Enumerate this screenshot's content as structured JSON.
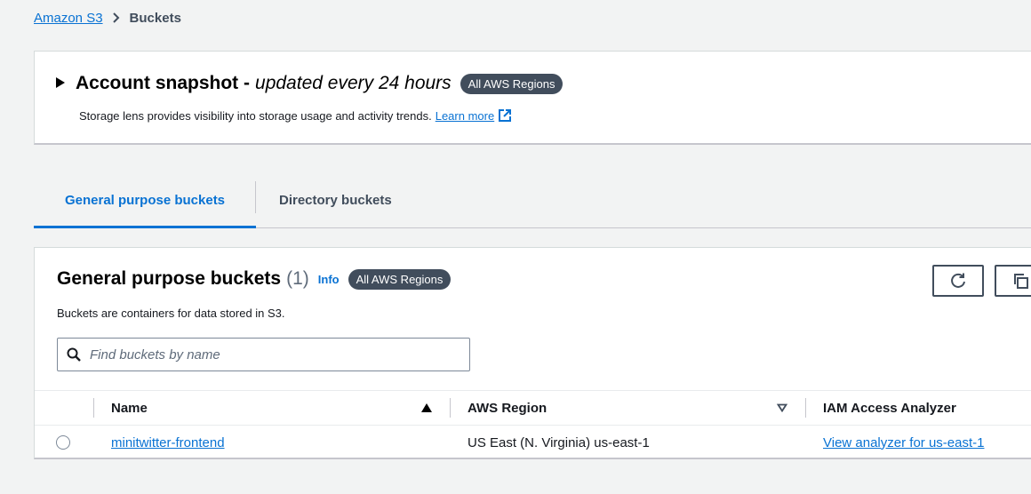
{
  "breadcrumb": {
    "root": "Amazon S3",
    "separator": ">",
    "current": "Buckets"
  },
  "snapshot": {
    "title": "Account snapshot -",
    "subtitle": "updated every 24 hours",
    "region_badge": "All AWS Regions",
    "description": "Storage lens provides visibility into storage usage and activity trends.",
    "learn_more": "Learn more"
  },
  "tabs": [
    {
      "label": "General purpose buckets",
      "active": true
    },
    {
      "label": "Directory buckets",
      "active": false
    }
  ],
  "buckets_panel": {
    "title": "General purpose buckets",
    "count": "(1)",
    "info": "Info",
    "region_badge": "All AWS Regions",
    "description": "Buckets are containers for data stored in S3.",
    "search_placeholder": "Find buckets by name"
  },
  "table": {
    "columns": [
      "Name",
      "AWS Region",
      "IAM Access Analyzer"
    ],
    "rows": [
      {
        "name": "minitwitter-frontend",
        "region": "US East (N. Virginia) us-east-1",
        "analyzer": "View analyzer for us-east-1"
      }
    ]
  },
  "colors": {
    "link": "#0972d3",
    "badge_bg": "#414d5c",
    "page_bg": "#f2f3f3"
  },
  "icons": [
    "caret-right-icon",
    "external-link-icon",
    "refresh-icon",
    "copy-icon",
    "search-icon",
    "sort-asc-icon",
    "sort-desc-icon"
  ]
}
